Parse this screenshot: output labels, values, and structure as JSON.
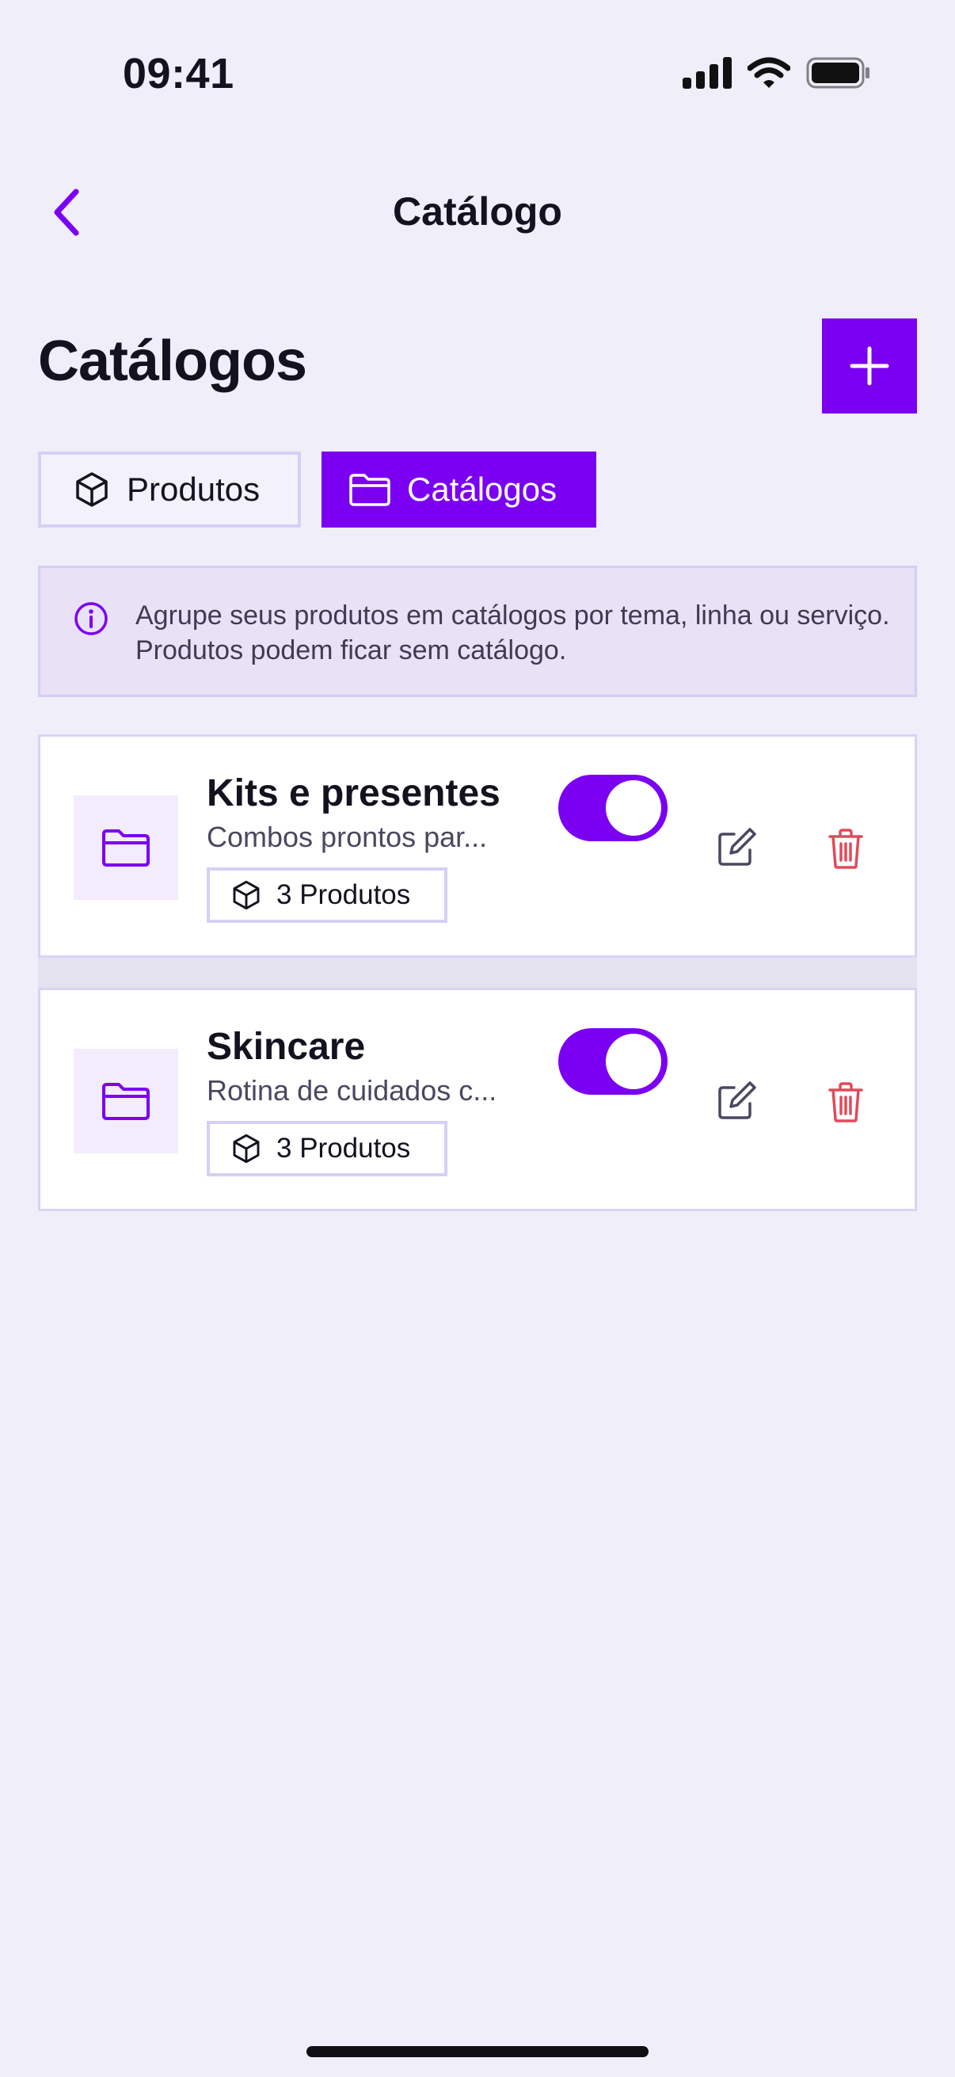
{
  "status_bar": {
    "time": "09:41"
  },
  "nav": {
    "title": "Catálogo"
  },
  "header": {
    "title": "Catálogos"
  },
  "tabs": [
    {
      "label": "Produtos",
      "icon": "box-icon",
      "active": false
    },
    {
      "label": "Catálogos",
      "icon": "folder-icon",
      "active": true
    }
  ],
  "info_banner": {
    "text": "Agrupe seus produtos em catálogos por tema, linha ou serviço. Produtos podem ficar sem catálogo."
  },
  "catalogs": [
    {
      "title": "Kits e presentes",
      "description": "Combos prontos par...",
      "products_badge": "3 Produtos",
      "enabled": true
    },
    {
      "title": "Skincare",
      "description": "Rotina de cuidados c...",
      "products_badge": "3 Produtos",
      "enabled": true
    }
  ],
  "colors": {
    "accent": "#7b00f2",
    "background": "#f0eef9",
    "delete": "#e04b5a",
    "info_background": "#e9e1f6"
  }
}
